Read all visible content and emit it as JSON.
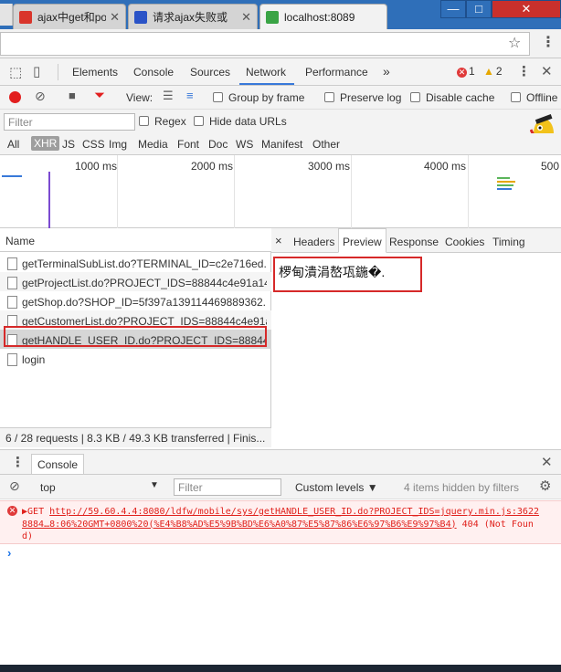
{
  "browser": {
    "tabs": [
      {
        "title": "ajax中get和pos",
        "favicon": "red-c-icon",
        "active": false
      },
      {
        "title": "请求ajax失败或",
        "favicon": "paw-icon",
        "active": false
      },
      {
        "title": "localhost:8089",
        "favicon": "check-icon",
        "active": true
      }
    ],
    "window_controls": {
      "minimize": "—",
      "maximize": "□",
      "close": "✕"
    }
  },
  "devtools": {
    "tabs": [
      "Elements",
      "Console",
      "Sources",
      "Network",
      "Performance"
    ],
    "active_tab": "Network",
    "more": "»",
    "error_count": "1",
    "warning_count": "2"
  },
  "network": {
    "view_label": "View:",
    "group_by_frame": "Group by frame",
    "preserve_log": "Preserve log",
    "disable_cache": "Disable cache",
    "offline": "Offline",
    "filter_placeholder": "Filter",
    "regex": "Regex",
    "hide_data_urls": "Hide data URLs",
    "types": [
      "All",
      "XHR",
      "JS",
      "CSS",
      "Img",
      "Media",
      "Font",
      "Doc",
      "WS",
      "Manifest",
      "Other"
    ],
    "selected_type": "XHR",
    "timeline_ticks": [
      "1000 ms",
      "2000 ms",
      "3000 ms",
      "4000 ms",
      "500"
    ],
    "list_header": "Name",
    "requests": [
      "getTerminalSubList.do?TERMINAL_ID=c2e716ed...",
      "getProjectList.do?PROJECT_IDS=88844c4e91a14...",
      "getShop.do?SHOP_ID=5f397a139114469889362...",
      "getCustomerList.do?PROJECT_IDS=88844c4e91a...",
      "getHANDLE_USER_ID.do?PROJECT_IDS=88844c4...",
      "login"
    ],
    "selected_request": 4,
    "summary": "6 / 28 requests  |  8.3 KB / 49.3 KB transferred  |  Finis..."
  },
  "detail": {
    "close": "×",
    "tabs": [
      "Headers",
      "Preview",
      "Response",
      "Cookies",
      "Timing"
    ],
    "active_tab": "Preview",
    "preview_text": "椤甸潰涓嶅瓨鍦�."
  },
  "console": {
    "drawer_tab": "Console",
    "context": "top",
    "filter_placeholder": "Filter",
    "levels": "Custom levels ▼",
    "hidden": "4 items hidden by filters",
    "error": {
      "method": "GET",
      "url": "http://59.60.4.4:8080/ldfw/mobile/sys/getHANDLE_USER_ID.do?PROJECT_IDS=8884…8:06%20GMT+0800%20(%E4%B8%AD%E5%9B%BD%E6%A0%87%E5%87%86%E6%97%B6%E9%97%B4)",
      "status": "404 (Not Found)",
      "source": "jquery.min.js:3622"
    },
    "prompt": "›"
  },
  "colors": {
    "accent": "#3879d9",
    "highlight": "#d62929",
    "error": "#e0201b",
    "tab_bar": "#2f6fb9"
  }
}
